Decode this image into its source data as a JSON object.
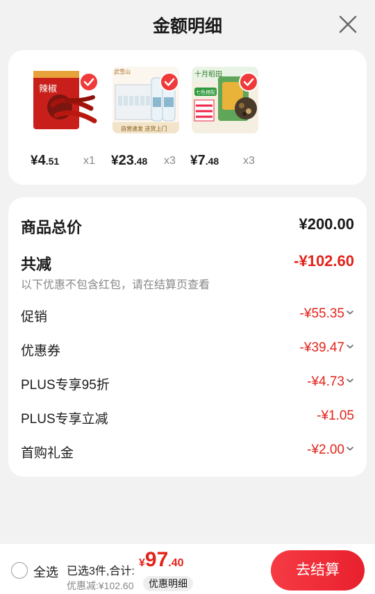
{
  "header": {
    "title": "金额明细"
  },
  "products": [
    {
      "price_int": "4",
      "price_dec": ".51",
      "qty": "x1",
      "thumb_text": "辣椒",
      "brand_label": ""
    },
    {
      "price_int": "23",
      "price_dec": ".48",
      "qty": "x3",
      "thumb_text": "自营速发 送货上门",
      "brand_label": "武雪山"
    },
    {
      "price_int": "7",
      "price_dec": ".48",
      "qty": "x3",
      "thumb_text": "十月稻田",
      "brand_label": "七色搭配"
    }
  ],
  "currency": "¥",
  "summary": {
    "total_label": "商品总价",
    "total_value": "¥200.00",
    "reduce_label": "共减",
    "reduce_value": "-¥102.60",
    "note": "以下优惠不包含红包，请在结算页查看",
    "details": [
      {
        "label": "促销",
        "value": "-¥55.35",
        "expandable": true
      },
      {
        "label": "优惠券",
        "value": "-¥39.47",
        "expandable": true
      },
      {
        "label": "PLUS专享95折",
        "value": "-¥4.73",
        "expandable": true
      },
      {
        "label": "PLUS专享立减",
        "value": "-¥1.05",
        "expandable": false
      },
      {
        "label": "首购礼金",
        "value": "-¥2.00",
        "expandable": true
      }
    ]
  },
  "bottom": {
    "select_all": "全选",
    "selected_text": "已选3件,合计:",
    "price_int": "97",
    "price_dec": ".40",
    "discount_text": "优惠减:¥102.60",
    "detail_label": "优惠明细",
    "checkout_label": "去结算"
  },
  "colors": {
    "accent": "#e2231a",
    "check": "#f03a3a"
  }
}
